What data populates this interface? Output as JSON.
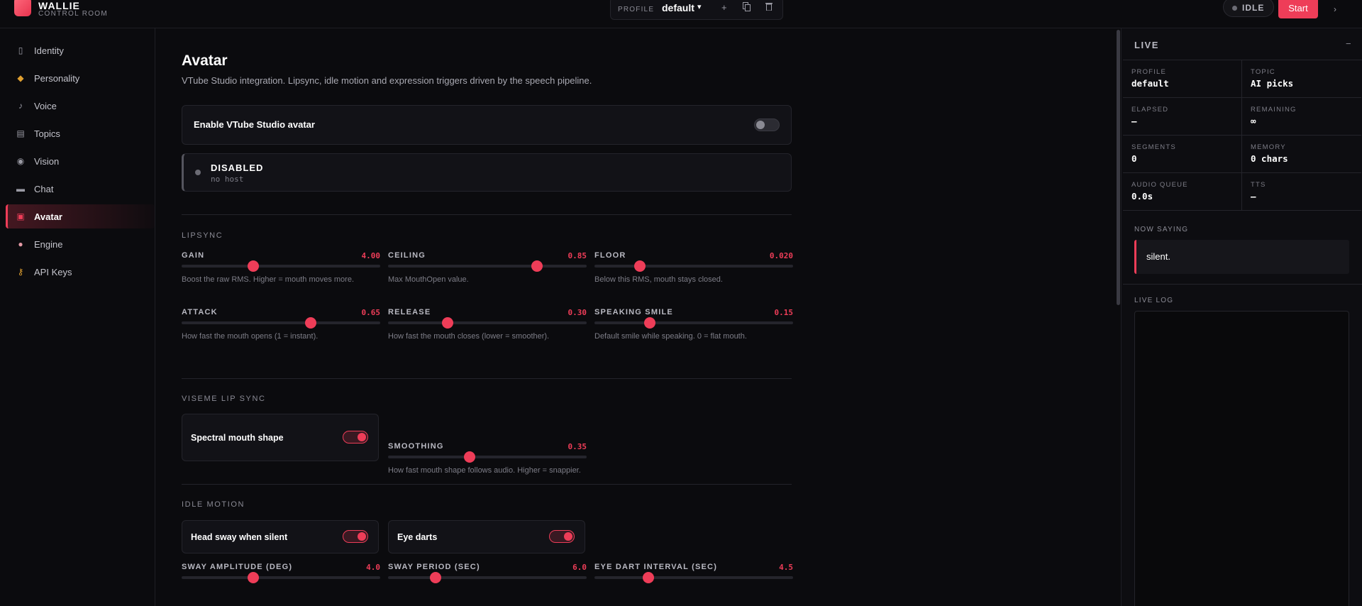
{
  "brand": {
    "name": "WALLIE",
    "subtitle": "CONTROL ROOM"
  },
  "topbar": {
    "profile_label": "PROFILE",
    "profile_value": "default",
    "add_icon": "+",
    "copy_icon": "copy-icon",
    "delete_icon": "trash-icon",
    "status": "IDLE",
    "start_label": "Start",
    "more_icon": "›"
  },
  "sidebar": {
    "items": [
      {
        "label": "Identity",
        "icon": "id-card-icon"
      },
      {
        "label": "Personality",
        "icon": "masks-icon"
      },
      {
        "label": "Voice",
        "icon": "microphone-icon"
      },
      {
        "label": "Topics",
        "icon": "notepad-icon"
      },
      {
        "label": "Vision",
        "icon": "eye-icon"
      },
      {
        "label": "Chat",
        "icon": "chat-bubble-icon"
      },
      {
        "label": "Avatar",
        "icon": "avatar-icon",
        "active": true
      },
      {
        "label": "Engine",
        "icon": "brain-icon"
      },
      {
        "label": "API Keys",
        "icon": "key-icon"
      }
    ]
  },
  "main": {
    "title": "Avatar",
    "description": "VTube Studio integration. Lipsync, idle motion and expression triggers driven by the speech pipeline.",
    "enable_label": "Enable VTube Studio avatar",
    "enable_on": false,
    "status_title": "DISABLED",
    "status_sub": "no host",
    "lipsync": {
      "title": "LIPSYNC",
      "sliders": [
        {
          "label": "GAIN",
          "value": "4.00",
          "fraction": 0.36,
          "help": "Boost the raw RMS. Higher = mouth moves more."
        },
        {
          "label": "CEILING",
          "value": "0.85",
          "fraction": 0.75,
          "help": "Max MouthOpen value."
        },
        {
          "label": "FLOOR",
          "value": "0.020",
          "fraction": 0.23,
          "help": "Below this RMS, mouth stays closed."
        },
        {
          "label": "ATTACK",
          "value": "0.65",
          "fraction": 0.65,
          "help": "How fast the mouth opens (1 = instant)."
        },
        {
          "label": "RELEASE",
          "value": "0.30",
          "fraction": 0.3,
          "help": "How fast the mouth closes (lower = smoother)."
        },
        {
          "label": "SPEAKING SMILE",
          "value": "0.15",
          "fraction": 0.28,
          "help": "Default smile while speaking. 0 = flat mouth."
        }
      ]
    },
    "viseme": {
      "title": "VISEME LIP SYNC",
      "spectral_label": "Spectral mouth shape",
      "spectral_on": true,
      "smoothing": {
        "label": "SMOOTHING",
        "value": "0.35",
        "fraction": 0.41,
        "help": "How fast mouth shape follows audio. Higher = snappier."
      }
    },
    "idle": {
      "title": "IDLE MOTION",
      "head_sway_label": "Head sway when silent",
      "head_sway_on": true,
      "eye_darts_label": "Eye darts",
      "eye_darts_on": true,
      "sliders": [
        {
          "label": "SWAY AMPLITUDE (DEG)",
          "value": "4.0",
          "fraction": 0.36
        },
        {
          "label": "SWAY PERIOD (SEC)",
          "value": "6.0",
          "fraction": 0.24
        },
        {
          "label": "EYE DART INTERVAL (SEC)",
          "value": "4.5",
          "fraction": 0.27
        }
      ]
    }
  },
  "live": {
    "title": "LIVE",
    "collapse_icon": "−",
    "stats": [
      {
        "key": "PROFILE",
        "value": "default"
      },
      {
        "key": "TOPIC",
        "value": "AI picks"
      },
      {
        "key": "ELAPSED",
        "value": "—"
      },
      {
        "key": "REMAINING",
        "value": "∞"
      },
      {
        "key": "SEGMENTS",
        "value": "0"
      },
      {
        "key": "MEMORY",
        "value": "0 chars"
      },
      {
        "key": "AUDIO QUEUE",
        "value": "0.0s"
      },
      {
        "key": "TTS",
        "value": "—"
      }
    ],
    "now_saying_label": "NOW SAYING",
    "now_saying": "silent.",
    "log_label": "LIVE LOG"
  },
  "colors": {
    "accent": "#ee3d58",
    "background": "#0b0b0e",
    "panel": "#121217"
  }
}
